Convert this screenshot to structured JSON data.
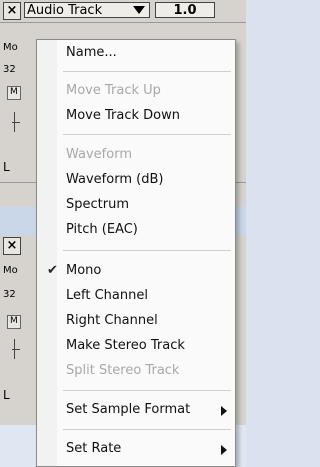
{
  "track_top": {
    "close_glyph": "×",
    "title": "Audio Track",
    "gain": "1.0",
    "info_line1": "Mo",
    "info_line2": "32",
    "side_btn_label": "M",
    "side_letter": "L"
  },
  "track_bottom": {
    "close_glyph": "×",
    "info_line1": "Mo",
    "info_line2": "32",
    "side_btn_label": "M",
    "side_letter": "L"
  },
  "menu": {
    "name": "Name...",
    "move_up": "Move Track Up",
    "move_down": "Move Track Down",
    "waveform": "Waveform",
    "waveform_db": "Waveform (dB)",
    "spectrum": "Spectrum",
    "pitch": "Pitch (EAC)",
    "mono": "Mono",
    "left_channel": "Left Channel",
    "right_channel": "Right Channel",
    "make_stereo": "Make Stereo Track",
    "split_stereo": "Split Stereo Track",
    "set_sample_format": "Set Sample Format",
    "set_rate": "Set Rate",
    "check_glyph": "✔"
  }
}
